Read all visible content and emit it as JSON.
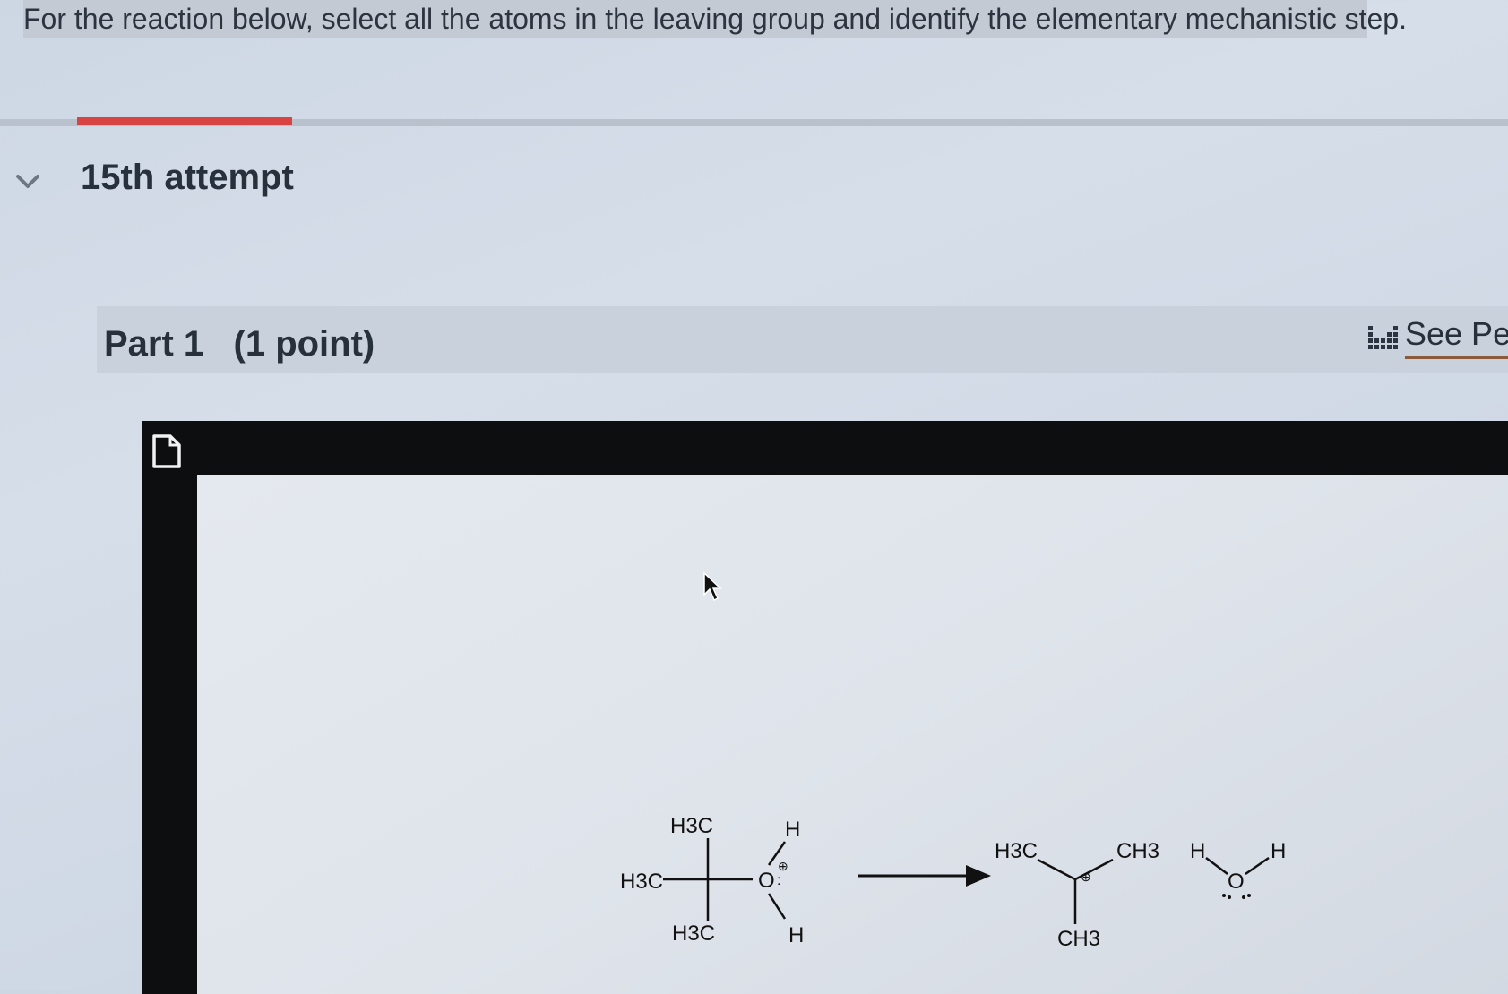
{
  "question": {
    "text": "For the reaction below, select all the atoms in the leaving group and identify the elementary mechanistic step."
  },
  "attempt": {
    "label": "15th attempt"
  },
  "part": {
    "title": "Part 1   (1 point)"
  },
  "see_periodic": {
    "label": "See Per"
  },
  "colors": {
    "progress": "#d84343",
    "frame": "#0d0e10"
  },
  "icons": [
    "chevron-down-icon",
    "periodic-table-icon",
    "document-icon",
    "mouse-cursor-icon"
  ],
  "reaction": {
    "reactant": {
      "top_group": "H3C",
      "left_group": "H3C",
      "bottom_group": "H3C",
      "oxygen": "O",
      "h_top": "H",
      "h_bottom": "H",
      "charge": "⊕"
    },
    "product_cation": {
      "left_group": "H3C",
      "right_group": "CH3",
      "bottom_group": "CH3",
      "charge": "⊕"
    },
    "product_water": {
      "h_left": "H",
      "oxygen": "O",
      "h_right": "H"
    }
  }
}
